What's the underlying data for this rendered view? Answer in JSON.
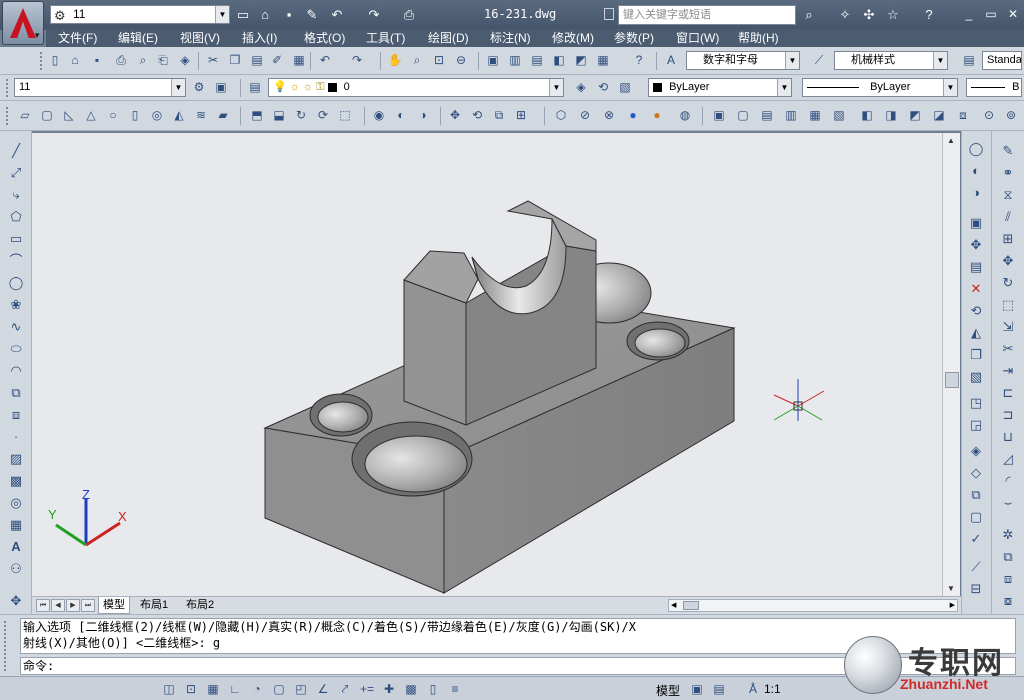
{
  "title_bar": {
    "workspace": "11",
    "document_title": "16-231.dwg",
    "search_placeholder": "键入关键字或短语",
    "app_logo": "A",
    "quick_access_icons": [
      "new-icon",
      "open-icon",
      "save-icon",
      "saveas-icon",
      "undo-icon",
      "redo-icon",
      "plot-icon"
    ],
    "info_icons": [
      "binoculars-icon",
      "wrench-icon",
      "satellite-icon",
      "star-icon",
      "help-icon"
    ]
  },
  "menu": [
    "文件(F)",
    "编辑(E)",
    "视图(V)",
    "插入(I)",
    "格式(O)",
    "工具(T)",
    "绘图(D)",
    "标注(N)",
    "修改(M)",
    "参数(P)",
    "窗口(W)",
    "帮助(H)"
  ],
  "toolbar_std": {
    "text_style": "数字和字母",
    "dim_style": "机械样式",
    "table_style": "Standa"
  },
  "toolbar_layers": {
    "workspace_combo": "11",
    "layer_combo": "0",
    "color_combo": "ByLayer",
    "linetype_combo": "ByLayer",
    "lineweight_combo": "B"
  },
  "tabs": [
    "模型",
    "布局1",
    "布局2"
  ],
  "axes": {
    "x": "X",
    "y": "Y",
    "z": "Z"
  },
  "command": {
    "history_line1": "输入选项 [二维线框(2)/线框(W)/隐藏(H)/真实(R)/概念(C)/着色(S)/带边缘着色(E)/灰度(G)/勾画(SK)/X",
    "history_line2": "射线(X)/其他(O)] <二维线框>: g",
    "prompt": "命令:"
  },
  "status": {
    "model_label": "模型",
    "scale": "1:1"
  },
  "watermark": {
    "cn": "专职网",
    "en": "Zhuanzhi.Net"
  },
  "colors": {
    "titlebar": "#4b5b70",
    "toolbar": "#d2d8e0",
    "canvas": "#e8e9ec",
    "accent_red": "#c8141e"
  }
}
